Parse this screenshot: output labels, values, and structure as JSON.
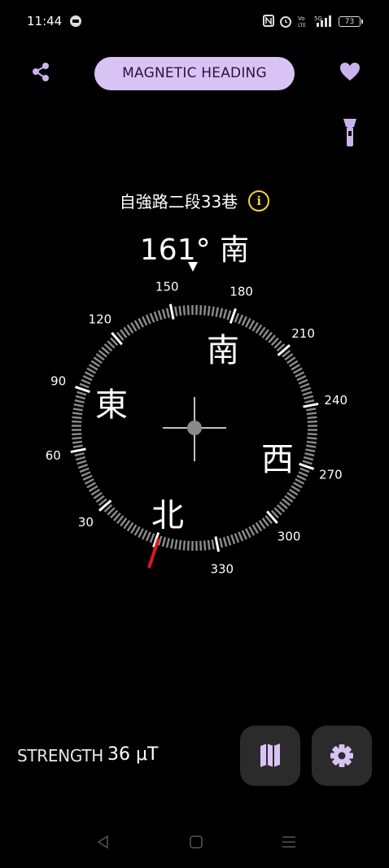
{
  "status_bar": {
    "time": "11:44",
    "battery": "73"
  },
  "header": {
    "mode_label": "MAGNETIC HEADING"
  },
  "location": {
    "address": "自強路二段33巷"
  },
  "heading": {
    "value": "161°",
    "direction": "南"
  },
  "compass": {
    "heading_deg": 161,
    "tick_labels": [
      "150",
      "180",
      "210",
      "240",
      "270",
      "300",
      "330",
      "30",
      "60",
      "90",
      "120"
    ],
    "cardinals": {
      "north": "北",
      "east": "東",
      "south": "南",
      "west": "西"
    }
  },
  "strength": {
    "label": "STRENGTH",
    "value": "36 μT"
  },
  "colors": {
    "accent": "#d9c2f4",
    "accent_icon": "#c9b3ec",
    "info": "#f3d33a",
    "north_needle": "#e01818"
  }
}
